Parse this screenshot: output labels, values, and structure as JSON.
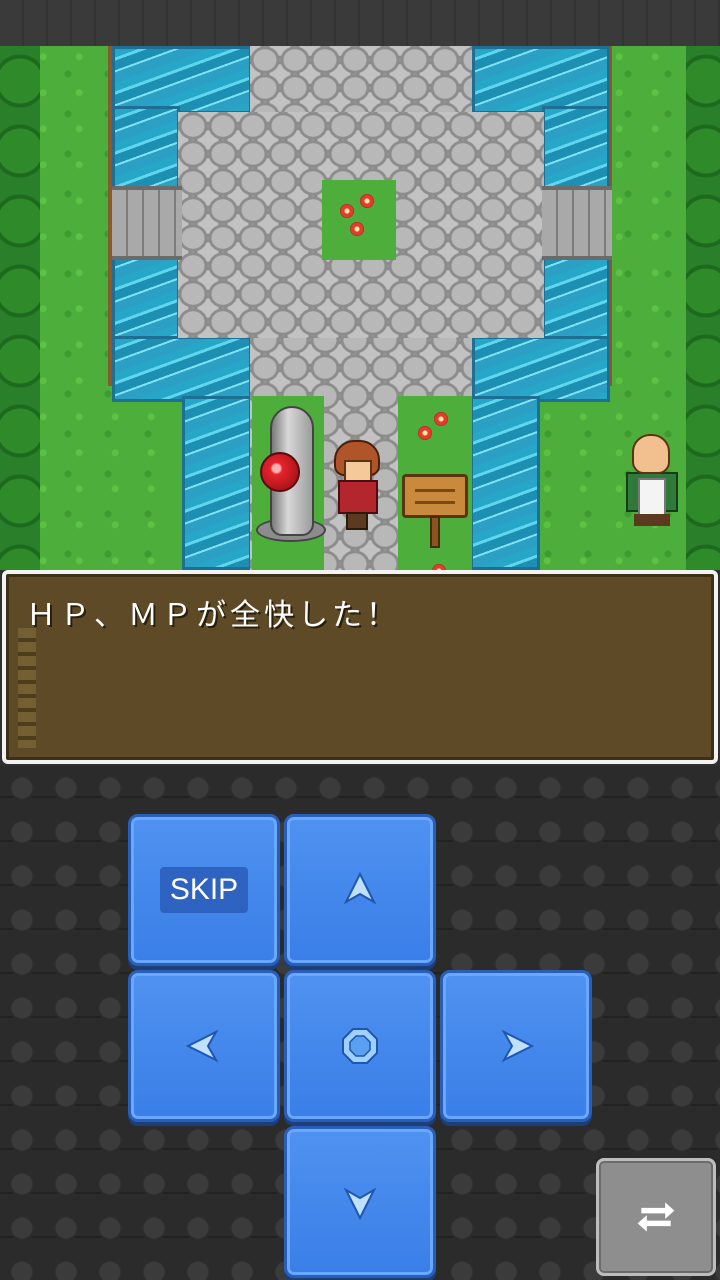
{
  "message": {
    "text": "ＨＰ、ＭＰが全快した！"
  },
  "controls": {
    "skip_label": "SKIP",
    "up_icon": "arrow-up-icon",
    "left_icon": "arrow-left-icon",
    "center_icon": "octagon-icon",
    "right_icon": "arrow-right-icon",
    "down_icon": "arrow-down-icon",
    "swap_icon": "repeat-icon"
  },
  "colors": {
    "pad_blue": "#3a7ee8",
    "message_bg": "#5e4a26",
    "message_border": "#f3f3f3"
  }
}
